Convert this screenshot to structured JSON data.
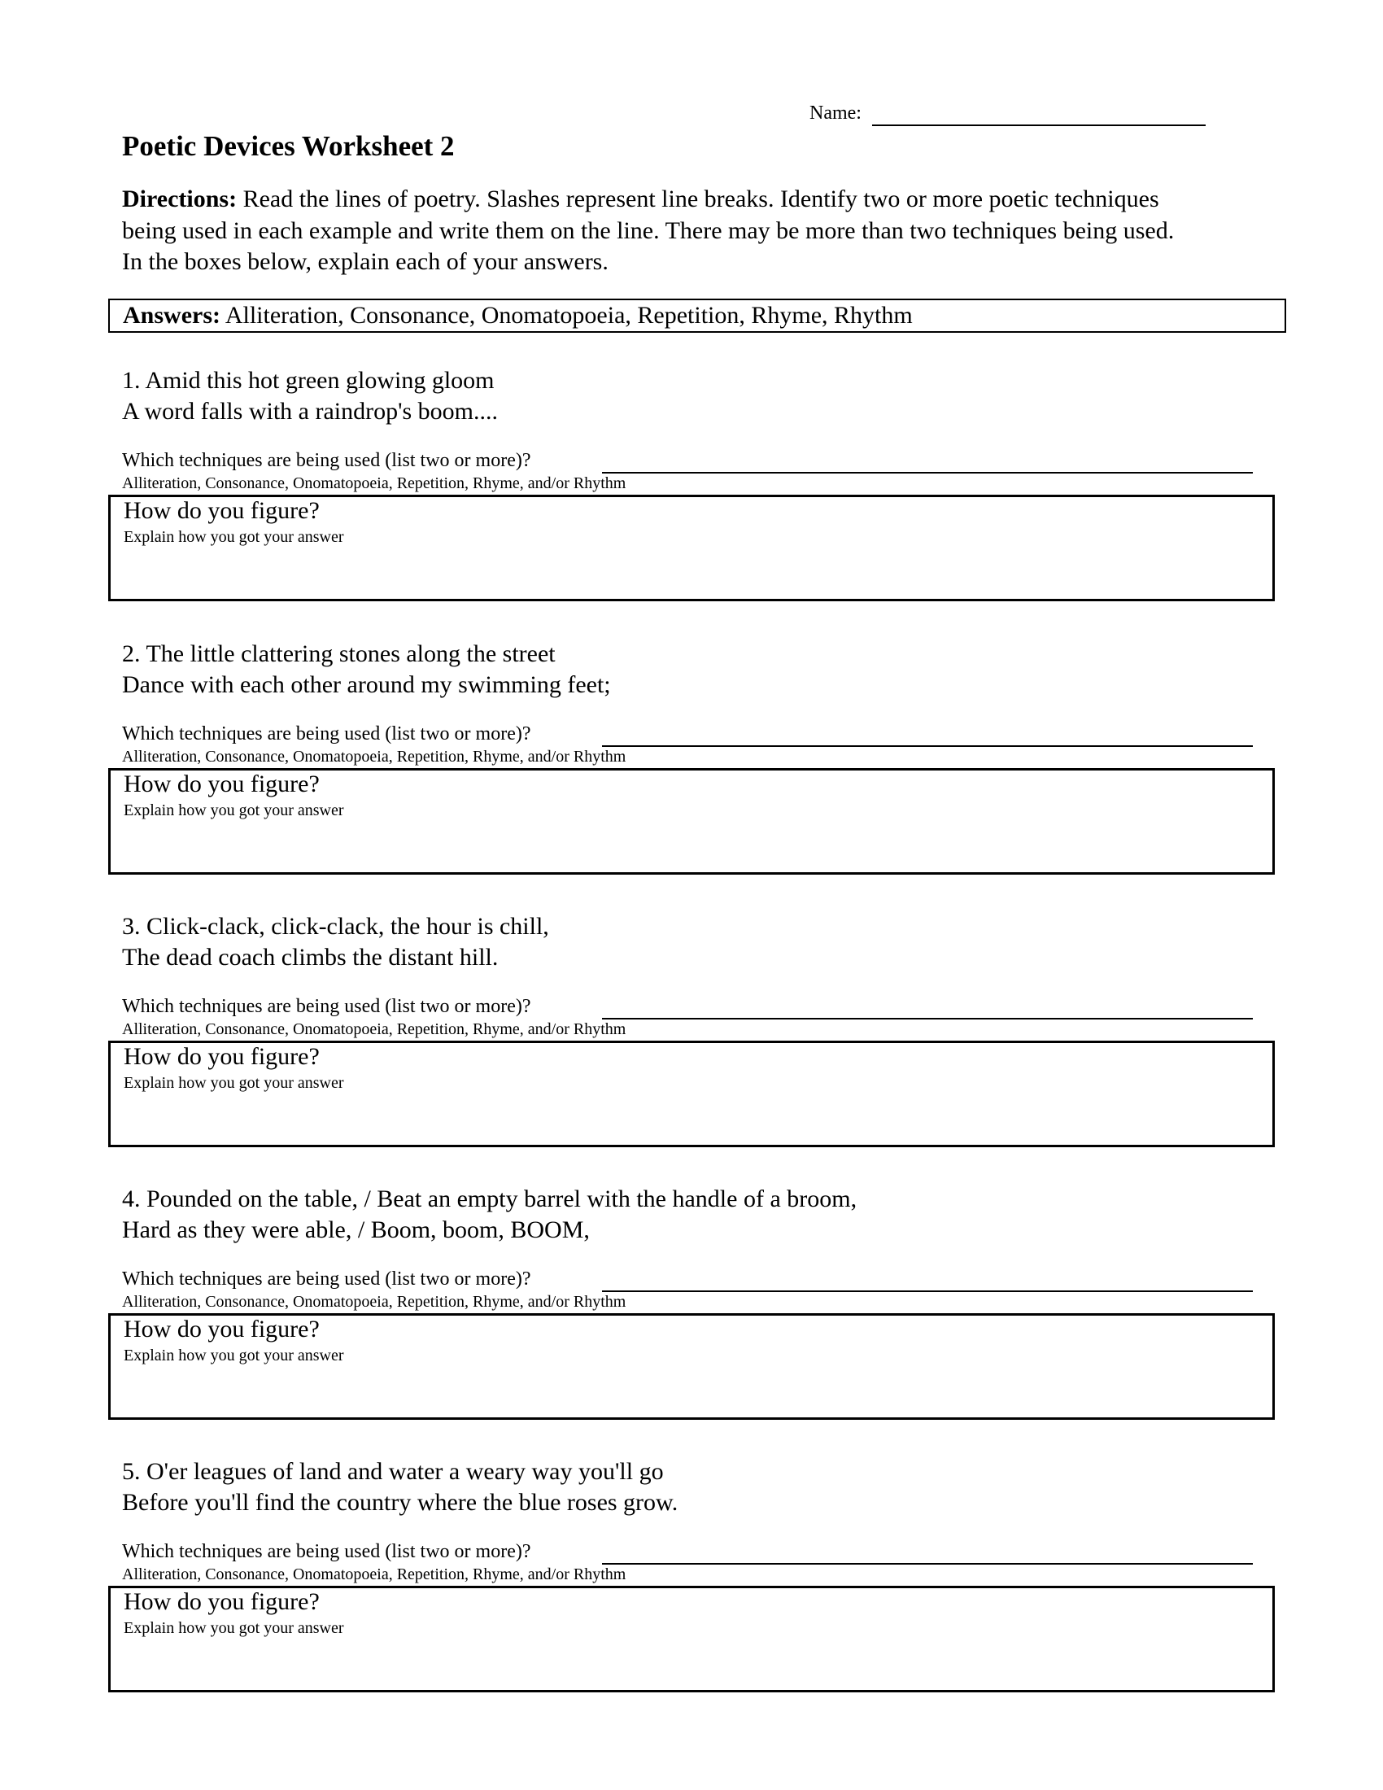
{
  "header": {
    "name_label": "Name:",
    "title": "Poetic Devices Worksheet 2"
  },
  "directions": {
    "label": "Directions:",
    "text": " Read the lines of poetry. Slashes represent line breaks. Identify two or more poetic techniques being used in each example and write them on the line. There may be more than two techniques being used. In the boxes below, explain each of your answers."
  },
  "answers": {
    "label": "Answers:",
    "text": " Alliteration, Consonance, Onomatopoeia, Repetition, Rhyme, Rhythm"
  },
  "questions": [
    {
      "line1": "1. Amid this hot green glowing gloom",
      "line2": " A word falls with a raindrop's boom....",
      "prompt": "Which techniques are being used (list two or more)?",
      "hint": "Alliteration, Consonance, Onomatopoeia, Repetition, Rhyme, and/or Rhythm",
      "box_title": "How do you figure?",
      "box_sub": "Explain how you got your answer"
    },
    {
      "line1": "2. The little clattering stones along the street",
      "line2": " Dance with each other around my swimming feet;",
      "prompt": "Which techniques are being used (list two or more)?",
      "hint": "Alliteration, Consonance, Onomatopoeia, Repetition, Rhyme, and/or Rhythm",
      "box_title": "How do you figure?",
      "box_sub": "Explain how you got your answer"
    },
    {
      "line1": "3. Click-clack, click-clack, the hour is chill,",
      "line2": "The dead coach climbs the distant hill.",
      "prompt": "Which techniques are being used (list two or more)?",
      "hint": "Alliteration, Consonance, Onomatopoeia, Repetition, Rhyme, and/or Rhythm",
      "box_title": "How do you figure?",
      "box_sub": "Explain how you got your answer"
    },
    {
      "line1": "4. Pounded on the table, / Beat an empty barrel with the handle of a broom,",
      "line2": " Hard as they were able, / Boom, boom, BOOM,",
      "prompt": "Which techniques are being used (list two or more)?",
      "hint": "Alliteration, Consonance, Onomatopoeia, Repetition, Rhyme, and/or Rhythm",
      "box_title": "How do you figure?",
      "box_sub": "Explain how you got your answer"
    },
    {
      "line1": "5. O'er leagues of land and water a weary way you'll go",
      "line2": "Before you'll find the country where the blue roses grow.",
      "prompt": "Which techniques are being used (list two or more)?",
      "hint": "Alliteration, Consonance, Onomatopoeia, Repetition, Rhyme, and/or Rhythm",
      "box_title": "How do you figure?",
      "box_sub": "Explain how you got your answer"
    }
  ]
}
